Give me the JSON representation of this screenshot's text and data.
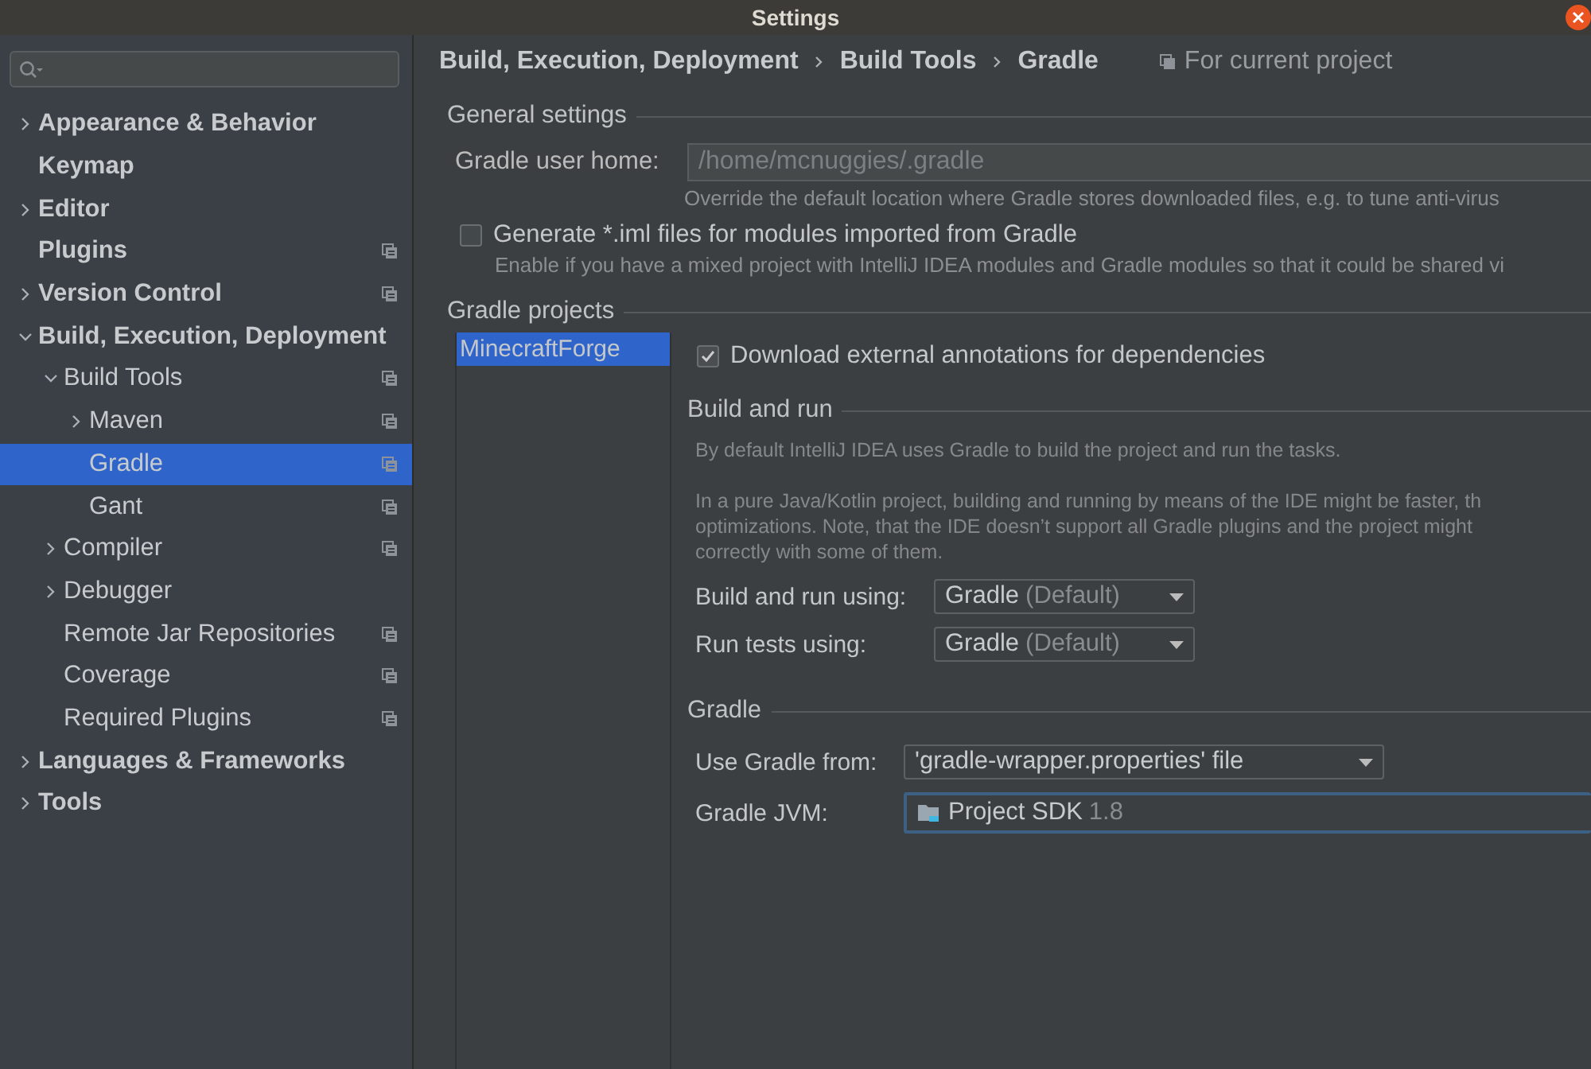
{
  "window": {
    "title": "Settings"
  },
  "sidebar": {
    "items": [
      {
        "label": "Appearance & Behavior",
        "bold": true,
        "expanded": false,
        "project_icon": false,
        "selected": false
      },
      {
        "label": "Keymap",
        "bold": true,
        "project_icon": false,
        "selected": false
      },
      {
        "label": "Editor",
        "bold": true,
        "expanded": false,
        "project_icon": false,
        "selected": false
      },
      {
        "label": "Plugins",
        "bold": true,
        "project_icon": true,
        "selected": false
      },
      {
        "label": "Version Control",
        "bold": true,
        "expanded": false,
        "project_icon": true,
        "selected": false
      },
      {
        "label": "Build, Execution, Deployment",
        "bold": true,
        "expanded": true,
        "project_icon": false,
        "selected": false,
        "children": [
          {
            "label": "Build Tools",
            "bold": false,
            "expanded": true,
            "project_icon": true,
            "selected": false,
            "children": [
              {
                "label": "Maven",
                "bold": false,
                "expanded": false,
                "project_icon": true,
                "selected": false
              },
              {
                "label": "Gradle",
                "bold": false,
                "project_icon": true,
                "selected": true
              },
              {
                "label": "Gant",
                "bold": false,
                "project_icon": true,
                "selected": false
              }
            ]
          },
          {
            "label": "Compiler",
            "bold": false,
            "expanded": false,
            "project_icon": true,
            "selected": false
          },
          {
            "label": "Debugger",
            "bold": false,
            "expanded": false,
            "project_icon": false,
            "selected": false
          },
          {
            "label": "Remote Jar Repositories",
            "bold": false,
            "project_icon": true,
            "selected": false
          },
          {
            "label": "Coverage",
            "bold": false,
            "project_icon": true,
            "selected": false
          },
          {
            "label": "Required Plugins",
            "bold": false,
            "project_icon": true,
            "selected": false
          }
        ]
      },
      {
        "label": "Languages & Frameworks",
        "bold": true,
        "expanded": false,
        "project_icon": false,
        "selected": false
      },
      {
        "label": "Tools",
        "bold": true,
        "expanded": false,
        "project_icon": false,
        "selected": false
      }
    ]
  },
  "breadcrumb": [
    "Build, Execution, Deployment",
    "Build Tools",
    "Gradle"
  ],
  "scope": "For current project",
  "general_settings": {
    "title": "General settings",
    "user_home": {
      "label": "Gradle user home:",
      "placeholder": "/home/mcnuggies/.gradle",
      "hint": "Override the default location where Gradle stores downloaded files, e.g. to tune anti-virus"
    },
    "generate_iml": {
      "label": "Generate *.iml files for modules imported from Gradle",
      "checked": false,
      "hint": "Enable if you have a mixed project with IntelliJ IDEA modules and Gradle modules so that it could be shared vi"
    }
  },
  "gradle_projects": {
    "title": "Gradle projects",
    "projects": [
      {
        "label": "MinecraftForge",
        "selected": true
      }
    ],
    "download_annotations": {
      "label": "Download external annotations for dependencies",
      "checked": true
    },
    "build_and_run": {
      "title": "Build and run",
      "description": [
        "By default IntelliJ IDEA uses Gradle to build the project and run the tasks.",
        "In a pure Java/Kotlin project, building and running by means of the IDE might be faster, th",
        "optimizations. Note, that the IDE doesn’t support all Gradle plugins and the project might",
        "correctly with some of them."
      ],
      "fields": [
        {
          "label": "Build and run using:",
          "value": "Gradle",
          "note": "(Default)"
        },
        {
          "label": "Run tests using:",
          "value": "Gradle",
          "note": "(Default)"
        }
      ]
    },
    "gradle": {
      "title": "Gradle",
      "use_from": {
        "label": "Use Gradle from:",
        "value": "'gradle-wrapper.properties' file"
      },
      "jvm": {
        "label": "Gradle JVM:",
        "value": "Project SDK",
        "note": "1.8",
        "focused": true
      }
    }
  }
}
